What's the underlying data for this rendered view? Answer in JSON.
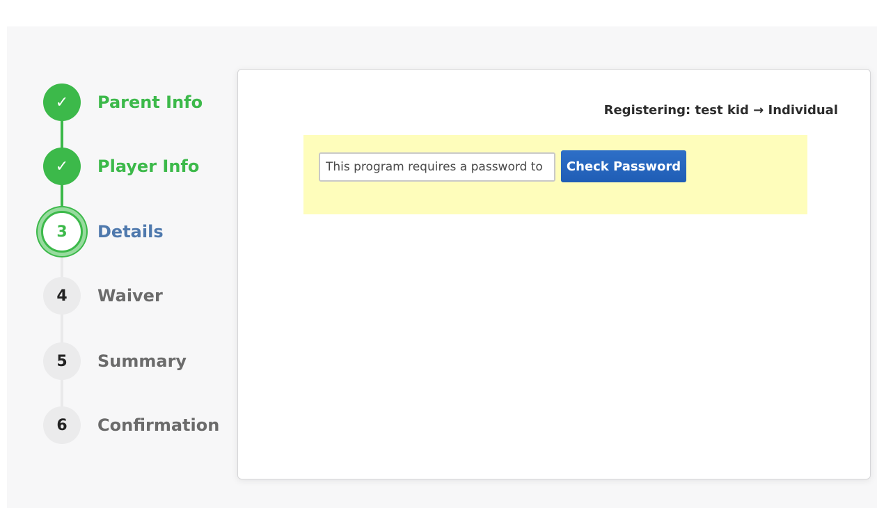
{
  "stepper": {
    "steps": [
      {
        "number": "1",
        "icon": "checkmark-icon",
        "glyph": "✓",
        "label": "Parent Info",
        "state": "done"
      },
      {
        "number": "2",
        "icon": "checkmark-icon",
        "glyph": "✓",
        "label": "Player Info",
        "state": "done"
      },
      {
        "number": "3",
        "glyph": "3",
        "label": "Details",
        "state": "current"
      },
      {
        "number": "4",
        "glyph": "4",
        "label": "Waiver",
        "state": "todo"
      },
      {
        "number": "5",
        "glyph": "5",
        "label": "Summary",
        "state": "todo"
      },
      {
        "number": "6",
        "glyph": "6",
        "label": "Confirmation",
        "state": "todo"
      }
    ]
  },
  "main": {
    "registering_text": "Registering: test kid → Individual",
    "password": {
      "value": "",
      "placeholder": "This program requires a password to",
      "button_label": "Check Password"
    }
  },
  "colors": {
    "done": "#3cb94a",
    "current_label": "#4f79ad",
    "panel_bg": "#fefdbb",
    "button_bg": "#2465be"
  }
}
